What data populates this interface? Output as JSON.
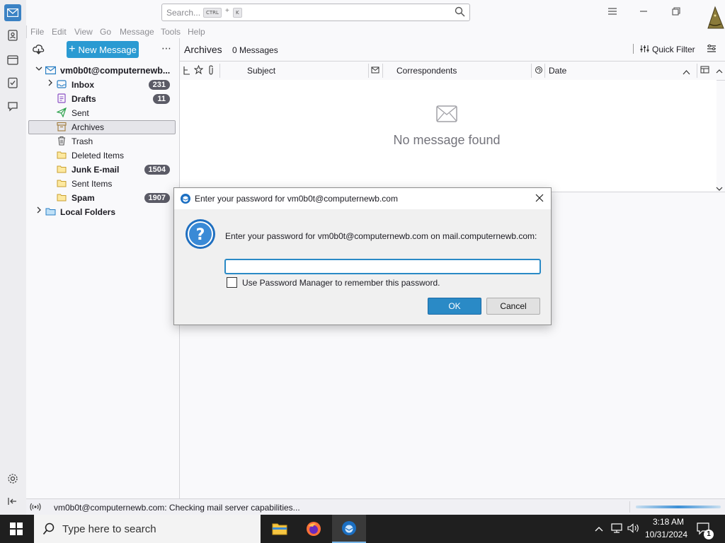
{
  "titlebar": {
    "search_placeholder": "Search...",
    "search_key1": "CTRL",
    "search_plus": "+",
    "search_key2": "K"
  },
  "menu": [
    "File",
    "Edit",
    "View",
    "Go",
    "Message",
    "Tools",
    "Help"
  ],
  "folder_pane": {
    "new_message_label": "New Message",
    "more_label": "⋯",
    "account": "vm0b0t@computernewb...",
    "folders": [
      {
        "name": "Inbox",
        "count": "231",
        "bold": true
      },
      {
        "name": "Drafts",
        "count": "11",
        "bold": true
      },
      {
        "name": "Sent",
        "count": "",
        "bold": false
      },
      {
        "name": "Archives",
        "count": "",
        "bold": false
      },
      {
        "name": "Trash",
        "count": "",
        "bold": false
      },
      {
        "name": "Deleted Items",
        "count": "",
        "bold": false
      },
      {
        "name": "Junk E-mail",
        "count": "1504",
        "bold": true
      },
      {
        "name": "Sent Items",
        "count": "",
        "bold": false
      },
      {
        "name": "Spam",
        "count": "1907",
        "bold": true
      }
    ],
    "local_folders": "Local Folders"
  },
  "message_list": {
    "folder_title": "Archives",
    "message_count": "0 Messages",
    "quick_filter": "Quick Filter",
    "columns": {
      "subject": "Subject",
      "correspondents": "Correspondents",
      "date": "Date"
    },
    "empty_text": "No message found"
  },
  "dialog": {
    "title": "Enter your password for vm0b0t@computernewb.com",
    "prompt": "Enter your password for vm0b0t@computernewb.com on mail.computernewb.com:",
    "password_value": "",
    "checkbox_label": "Use Password Manager to remember this password.",
    "ok_label": "OK",
    "cancel_label": "Cancel"
  },
  "statusbar": {
    "text": "vm0b0t@computernewb.com: Checking mail server capabilities..."
  },
  "taskbar": {
    "search_placeholder": "Type here to search",
    "time": "3:18 AM",
    "date": "10/31/2024",
    "notification_count": "1"
  },
  "colors": {
    "accent": "#2a9ad2",
    "badge": "#5b5b66",
    "dialog_input_border": "#2a8ac6"
  }
}
